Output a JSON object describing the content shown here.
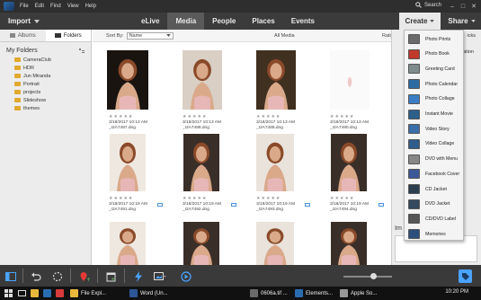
{
  "titlebar": {
    "menus": [
      "File",
      "Edit",
      "Find",
      "View",
      "Help"
    ],
    "search_label": "Search"
  },
  "topnav": {
    "import_label": "Import",
    "tabs": [
      {
        "label": "eLive",
        "active": false
      },
      {
        "label": "Media",
        "active": true
      },
      {
        "label": "People",
        "active": false
      },
      {
        "label": "Places",
        "active": false
      },
      {
        "label": "Events",
        "active": false
      }
    ],
    "create_label": "Create",
    "share_label": "Share"
  },
  "sidebar": {
    "tabs": [
      {
        "label": "Albums",
        "active": false
      },
      {
        "label": "Folders",
        "active": true
      }
    ],
    "header": "My Folders",
    "folders": [
      "CameraClub",
      "HDR",
      "Jun Miranda",
      "Portrait",
      "projects",
      "Slideshow",
      "themes"
    ]
  },
  "content_bar": {
    "sort_label": "Sort By:",
    "sort_value": "Name",
    "scope_label": "All Media",
    "ratings_label": "Ratings"
  },
  "grid": {
    "stars": "★★★★★",
    "items": [
      {
        "date": "3/18/2017 10:13 AM",
        "file": "_I2A7487.dng",
        "stacked": false
      },
      {
        "date": "3/18/2017 10:13 AM",
        "file": "_I2A7488.dng",
        "stacked": false
      },
      {
        "date": "3/18/2017 10:13 AM",
        "file": "_I2A7489.dng",
        "stacked": false
      },
      {
        "date": "3/18/2017 10:13 AM",
        "file": "_I2A7490.dng",
        "stacked": false
      },
      {
        "date": "3/18/2017 10:19 AM",
        "file": "_I2A7491.dng",
        "stacked": true
      },
      {
        "date": "3/18/2017 10:19 AM",
        "file": "_I2A7492.dng",
        "stacked": true
      },
      {
        "date": "3/18/2017 10:19 AM",
        "file": "_I2A7493.dng",
        "stacked": true
      },
      {
        "date": "3/18/2017 10:19 AM",
        "file": "_I2A7494.dng",
        "stacked": true
      },
      {
        "date": "",
        "file": "",
        "stacked": false
      },
      {
        "date": "",
        "file": "",
        "stacked": false
      },
      {
        "date": "",
        "file": "",
        "stacked": false
      },
      {
        "date": "",
        "file": "",
        "stacked": false
      }
    ]
  },
  "right_panel": {
    "picks_fragment": "icks",
    "ation_fragment": "ation",
    "im_fragment": "Im"
  },
  "create_menu": {
    "items": [
      {
        "label": "Photo Prints",
        "icon": "photo-prints-icon",
        "color": "#6b6b6b"
      },
      {
        "label": "Photo Book",
        "icon": "photo-book-icon",
        "color": "#c0392b"
      },
      {
        "label": "Greeting Card",
        "icon": "greeting-card-icon",
        "color": "#7f8c8d"
      },
      {
        "label": "Photo Calendar",
        "icon": "photo-calendar-icon",
        "color": "#2c6ca3"
      },
      {
        "label": "Photo Collage",
        "icon": "photo-collage-icon",
        "color": "#3b7dc4"
      },
      {
        "label": "Instant Movie",
        "icon": "instant-movie-icon",
        "color": "#2c5f8a"
      },
      {
        "label": "Video Story",
        "icon": "video-story-icon",
        "color": "#3a6fa8"
      },
      {
        "label": "Video Collage",
        "icon": "video-collage-icon",
        "color": "#2f5d8c"
      },
      {
        "label": "DVD with Menu",
        "icon": "dvd-menu-icon",
        "color": "#888888"
      },
      {
        "label": "Facebook Cover",
        "icon": "facebook-cover-icon",
        "color": "#3b5998"
      },
      {
        "label": "CD Jacket",
        "icon": "cd-jacket-icon",
        "color": "#2c3e50"
      },
      {
        "label": "DVD Jacket",
        "icon": "dvd-jacket-icon",
        "color": "#34495e"
      },
      {
        "label": "CD/DVD Label",
        "icon": "cd-dvd-label-icon",
        "color": "#555555"
      },
      {
        "label": "Memories",
        "icon": "memories-icon",
        "color": "#2d4f7c"
      }
    ]
  },
  "taskbar": {
    "items": [
      {
        "label": "File Expl...",
        "icon": "file-explorer-icon",
        "color": "#e8b93a"
      },
      {
        "label": "Word (Un...",
        "icon": "word-icon",
        "color": "#2b5797"
      },
      {
        "label": "0606a.tif ...",
        "icon": "image-file-icon",
        "color": "#6a6a6a"
      },
      {
        "label": "Elements...",
        "icon": "elements-icon",
        "color": "#2a6cb0"
      },
      {
        "label": "Apple So...",
        "icon": "apple-software-icon",
        "color": "#999999"
      }
    ],
    "clock": "10:20 PM"
  },
  "colors": {
    "titlebar_bg": "#2e2e2e",
    "nav_bg": "#3b3b3b",
    "accent_blue": "#2a6cb0"
  }
}
